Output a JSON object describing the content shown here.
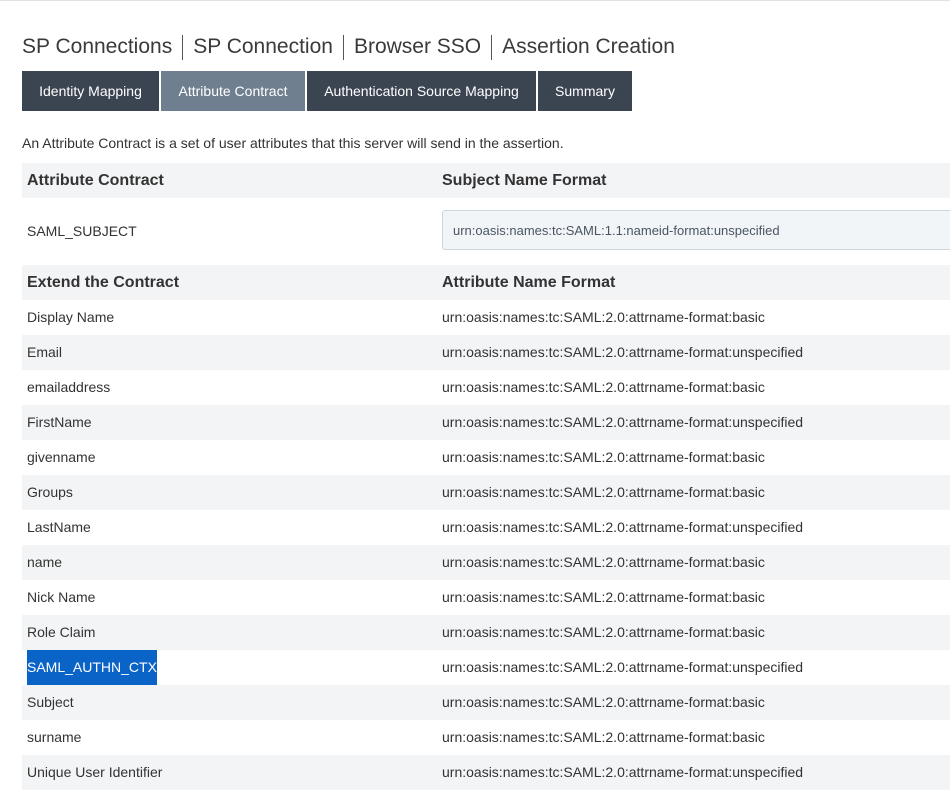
{
  "breadcrumb": [
    "SP Connections",
    "SP Connection",
    "Browser SSO",
    "Assertion Creation"
  ],
  "tabs": [
    {
      "label": "Identity Mapping",
      "active": false
    },
    {
      "label": "Attribute Contract",
      "active": true
    },
    {
      "label": "Authentication Source Mapping",
      "active": false
    },
    {
      "label": "Summary",
      "active": false
    }
  ],
  "description": "An Attribute Contract is a set of user attributes that this server will send in the assertion.",
  "contract_table": {
    "col1_header": "Attribute Contract",
    "col2_header": "Subject Name Format",
    "subject_attribute": "SAML_SUBJECT",
    "subject_format": "urn:oasis:names:tc:SAML:1.1:nameid-format:unspecified"
  },
  "extend_table": {
    "col1_header": "Extend the Contract",
    "col2_header": "Attribute Name Format",
    "rows": [
      {
        "name": "Display Name",
        "format": "urn:oasis:names:tc:SAML:2.0:attrname-format:basic"
      },
      {
        "name": "Email",
        "format": "urn:oasis:names:tc:SAML:2.0:attrname-format:unspecified"
      },
      {
        "name": "emailaddress",
        "format": "urn:oasis:names:tc:SAML:2.0:attrname-format:basic"
      },
      {
        "name": "FirstName",
        "format": "urn:oasis:names:tc:SAML:2.0:attrname-format:unspecified"
      },
      {
        "name": "givenname",
        "format": "urn:oasis:names:tc:SAML:2.0:attrname-format:basic"
      },
      {
        "name": "Groups",
        "format": "urn:oasis:names:tc:SAML:2.0:attrname-format:basic"
      },
      {
        "name": "LastName",
        "format": "urn:oasis:names:tc:SAML:2.0:attrname-format:unspecified"
      },
      {
        "name": "name",
        "format": "urn:oasis:names:tc:SAML:2.0:attrname-format:basic"
      },
      {
        "name": "Nick Name",
        "format": "urn:oasis:names:tc:SAML:2.0:attrname-format:basic"
      },
      {
        "name": "Role Claim",
        "format": "urn:oasis:names:tc:SAML:2.0:attrname-format:basic"
      },
      {
        "name": "SAML_AUTHN_CTX",
        "format": "urn:oasis:names:tc:SAML:2.0:attrname-format:unspecified",
        "text_selected": true
      },
      {
        "name": "Subject",
        "format": "urn:oasis:names:tc:SAML:2.0:attrname-format:basic"
      },
      {
        "name": "surname",
        "format": "urn:oasis:names:tc:SAML:2.0:attrname-format:basic"
      },
      {
        "name": "Unique User Identifier",
        "format": "urn:oasis:names:tc:SAML:2.0:attrname-format:unspecified"
      }
    ]
  },
  "colors": {
    "tab_bg": "#3b4551",
    "tab_active_bg": "#6f7f90",
    "row_shade": "#f3f4f6",
    "selection": "#0a64c8"
  }
}
